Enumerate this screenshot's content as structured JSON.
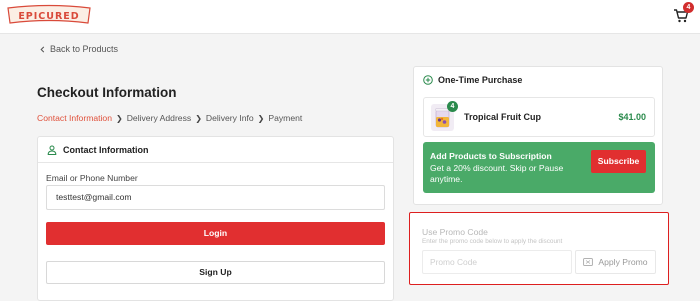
{
  "header": {
    "logo_text": "EPICURED",
    "cart_count": "4"
  },
  "back_link": {
    "label": "Back to Products"
  },
  "checkout": {
    "title": "Checkout Information",
    "steps": [
      "Contact Information",
      "Delivery Address",
      "Delivery Info",
      "Payment"
    ],
    "active_step": "Contact Information"
  },
  "contact_card": {
    "heading": "Contact Information",
    "field_label": "Email or Phone Number",
    "email_value": "testtest@gmail.com",
    "login_label": "Login",
    "signup_label": "Sign Up"
  },
  "order_summary": {
    "heading": "One-Time Purchase",
    "product": {
      "name": "Tropical Fruit Cup",
      "price": "$41.00",
      "quantity": "4"
    },
    "subscription": {
      "title": "Add Products to Subscription",
      "text": "Get a 20% discount. Skip or Pause anytime.",
      "button_label": "Subscribe"
    }
  },
  "promo": {
    "title": "Use Promo Code",
    "subtitle": "Enter the promo code below to apply the discount",
    "placeholder": "Promo Code",
    "apply_label": "Apply Promo"
  },
  "colors": {
    "brand_red": "#e12f30",
    "accent_orange": "#e0503a",
    "green": "#4aaa68",
    "price_green": "#2a8a4c",
    "highlight_border": "#dd1f1f"
  }
}
